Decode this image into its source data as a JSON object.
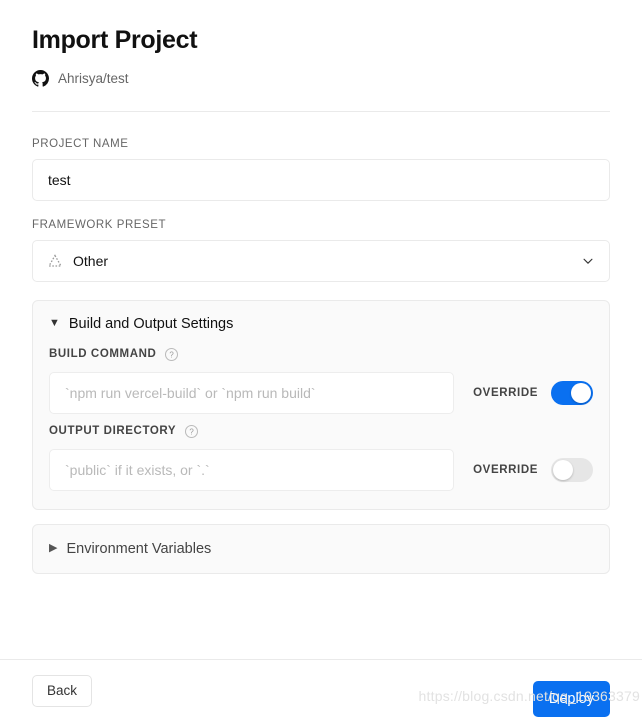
{
  "header": {
    "title": "Import Project",
    "repo": "Ahrisya/test",
    "repo_icon": "github-icon"
  },
  "form": {
    "project_name": {
      "label": "PROJECT NAME",
      "value": "test",
      "placeholder": ""
    },
    "framework_preset": {
      "label": "FRAMEWORK PRESET",
      "value": "Other",
      "icon": "dotted-triangle-icon",
      "chevron": "chevron-down-icon"
    }
  },
  "build_panel": {
    "title": "Build and Output Settings",
    "expanded": true,
    "marker": "▼",
    "build_command": {
      "label": "BUILD COMMAND",
      "help_icon": "question-circle-icon",
      "value": "",
      "placeholder": "`npm run vercel-build` or `npm run build`",
      "override_label": "OVERRIDE",
      "override_on": true
    },
    "output_directory": {
      "label": "OUTPUT DIRECTORY",
      "help_icon": "question-circle-icon",
      "value": "",
      "placeholder": "`public` if it exists, or `.`",
      "override_label": "OVERRIDE",
      "override_on": false
    }
  },
  "env_panel": {
    "title": "Environment Variables",
    "expanded": false,
    "marker": "▶"
  },
  "footer": {
    "back_label": "Back",
    "deploy_label": "Deploy"
  },
  "watermark": "https://blog.csdn.net/qq_19363379",
  "colors": {
    "accent": "#0a70f0",
    "border": "#eaeaea",
    "panel_bg": "#fafafa",
    "muted_text": "#666666",
    "toggle_off": "#e6e6e6"
  }
}
